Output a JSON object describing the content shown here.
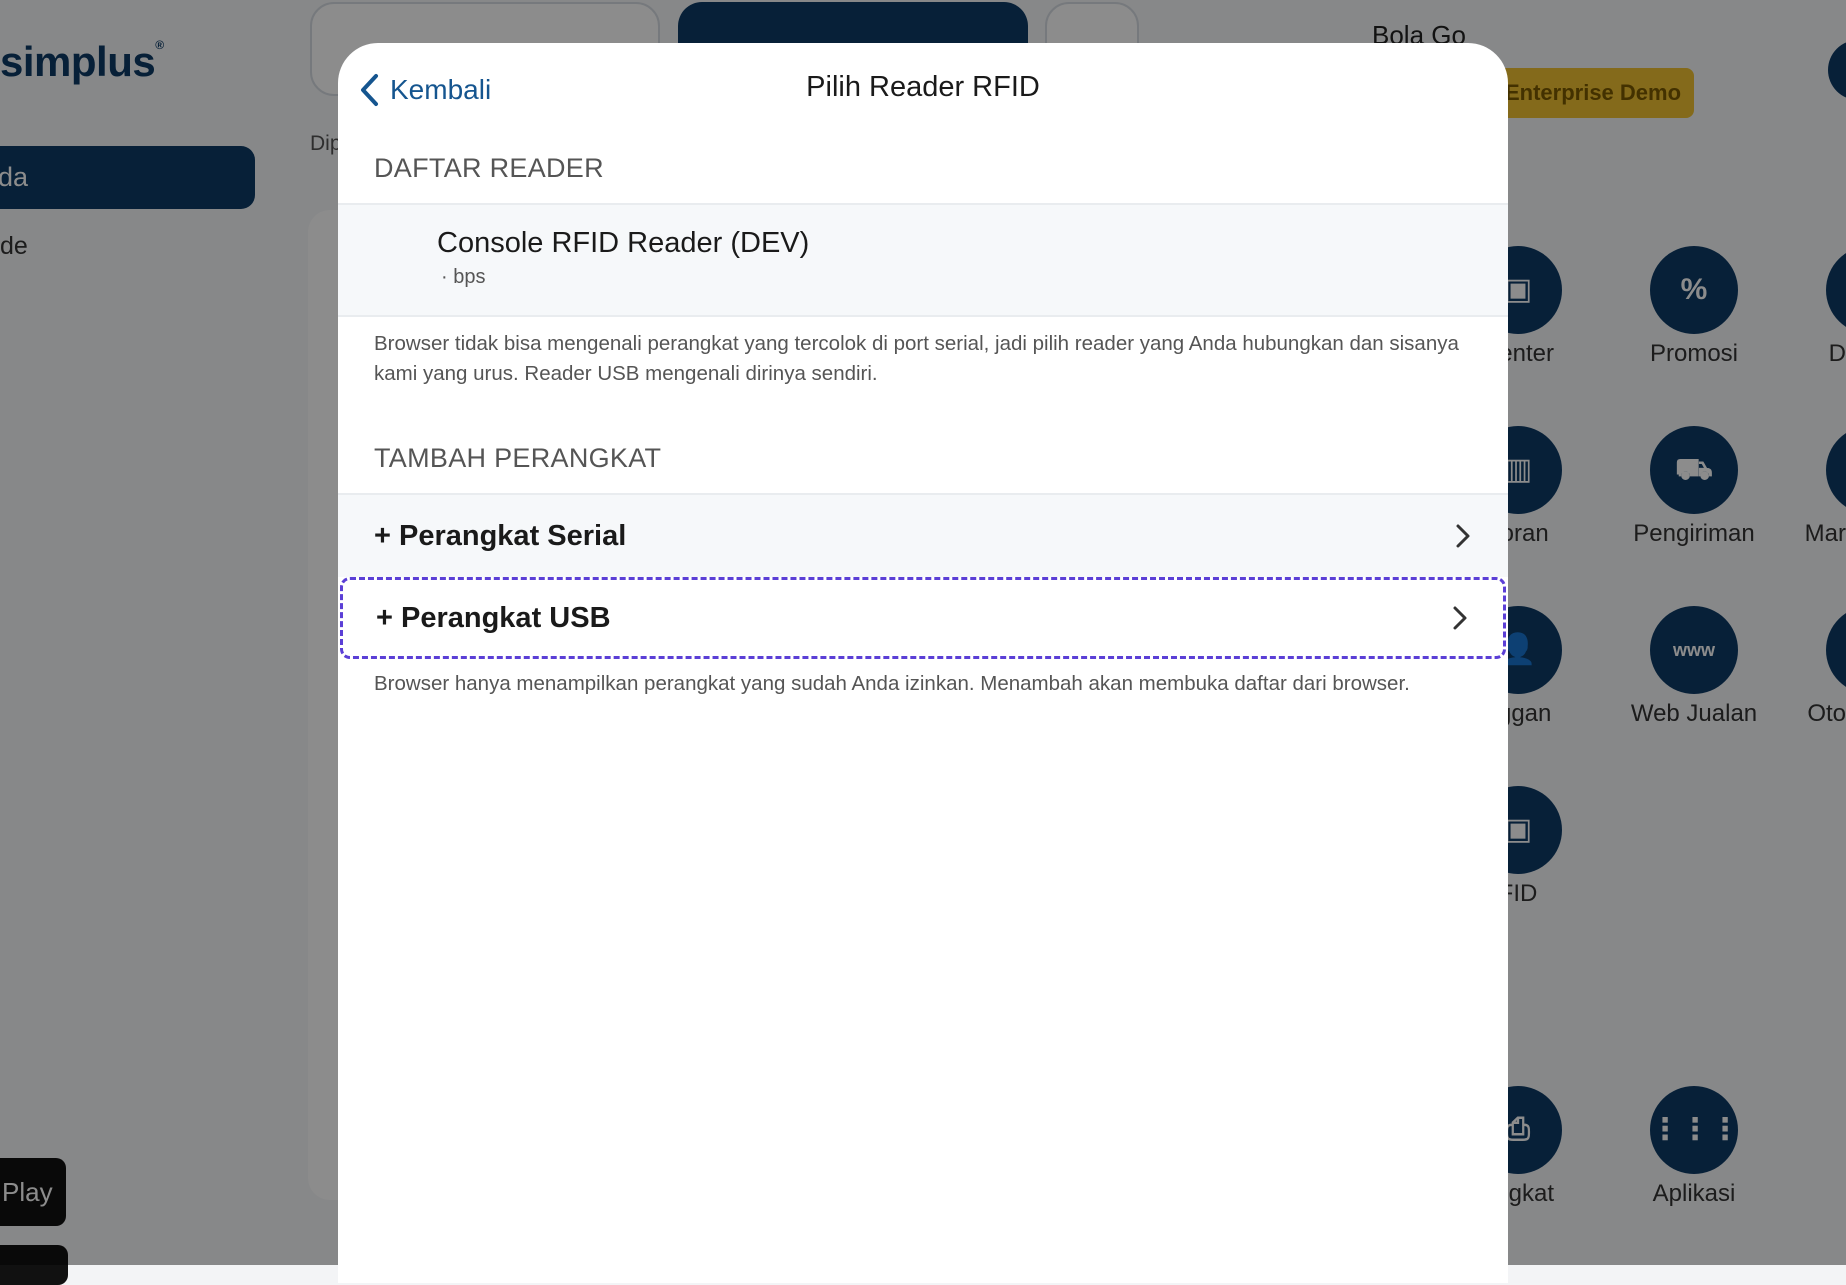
{
  "background": {
    "logo": "simplus",
    "sidebar": {
      "active_item": "da",
      "item_2": "de"
    },
    "dip_label": "Dip",
    "user_name": "Bola Go",
    "plan_badge": "Enterprise Demo",
    "menu": [
      {
        "label": "Center",
        "icon": "box-icon"
      },
      {
        "label": "Promosi",
        "icon": "percent-icon"
      },
      {
        "label": "D",
        "icon": "generic-icon"
      },
      {
        "label": "poran",
        "icon": "report-icon"
      },
      {
        "label": "Pengiriman",
        "icon": "truck-icon"
      },
      {
        "label": "Mar",
        "icon": "generic-icon"
      },
      {
        "label": "nggan",
        "icon": "users-icon"
      },
      {
        "label": "Web Jualan",
        "icon": "www-icon"
      },
      {
        "label": "Oto",
        "icon": "generic-icon"
      },
      {
        "label": "FID",
        "icon": "rfid-icon"
      },
      {
        "label": "angkat",
        "icon": "printer-icon"
      },
      {
        "label": "Aplikasi",
        "icon": "grid-icon"
      }
    ],
    "store_button": "Play",
    "colors": {
      "primary": "#0d3b66",
      "badge": "#f1c232"
    }
  },
  "modal": {
    "back_label": "Kembali",
    "title": "Pilih Reader RFID",
    "reader_section": {
      "header": "DAFTAR READER",
      "readers": [
        {
          "name": "Console RFID Reader (DEV)",
          "sub": "· bps"
        }
      ],
      "note": "Browser tidak bisa mengenali perangkat yang tercolok di port serial, jadi pilih reader yang Anda hubungkan dan sisanya kami yang urus. Reader USB mengenali dirinya sendiri."
    },
    "add_section": {
      "header": "TAMBAH PERANGKAT",
      "serial_label": "+ Perangkat Serial",
      "usb_label": "+ Perangkat USB",
      "note": "Browser hanya menampilkan perangkat yang sudah Anda izinkan. Menambah akan membuka daftar dari browser."
    },
    "colors": {
      "link": "#15558f",
      "focus_outline": "#5b3fd6"
    }
  }
}
